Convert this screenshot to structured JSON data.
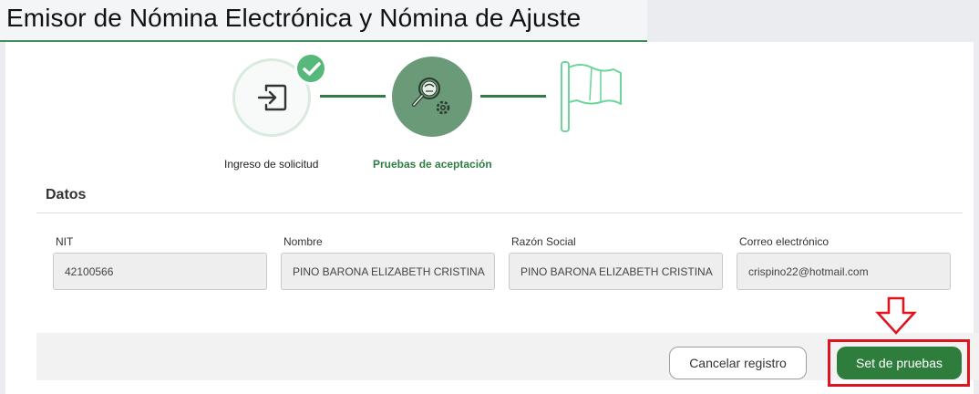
{
  "page": {
    "title": "Emisor de Nómina Electrónica y Nómina de Ajuste"
  },
  "stepper": {
    "steps": [
      {
        "label": "Ingreso de solicitud",
        "status": "completed",
        "icon": "sign-in-icon"
      },
      {
        "label": "Pruebas de aceptación",
        "status": "active",
        "icon": "search-gear-icon"
      },
      {
        "label": "",
        "status": "pending",
        "icon": "flag-icon"
      }
    ]
  },
  "datos": {
    "title": "Datos",
    "fields": [
      {
        "label": "NIT",
        "value": "42100566"
      },
      {
        "label": "Nombre",
        "value": "PINO BARONA ELIZABETH CRISTINA"
      },
      {
        "label": "Razón Social",
        "value": "PINO BARONA ELIZABETH CRISTINA"
      },
      {
        "label": "Correo electrónico",
        "value": "crispino22@hotmail.com"
      }
    ]
  },
  "actions": {
    "cancel_label": "Cancelar registro",
    "primary_label": "Set de pruebas"
  },
  "colors": {
    "accent_green": "#2e7d3c",
    "completed_check": "#56b87b",
    "highlight_red": "#e0141e"
  }
}
